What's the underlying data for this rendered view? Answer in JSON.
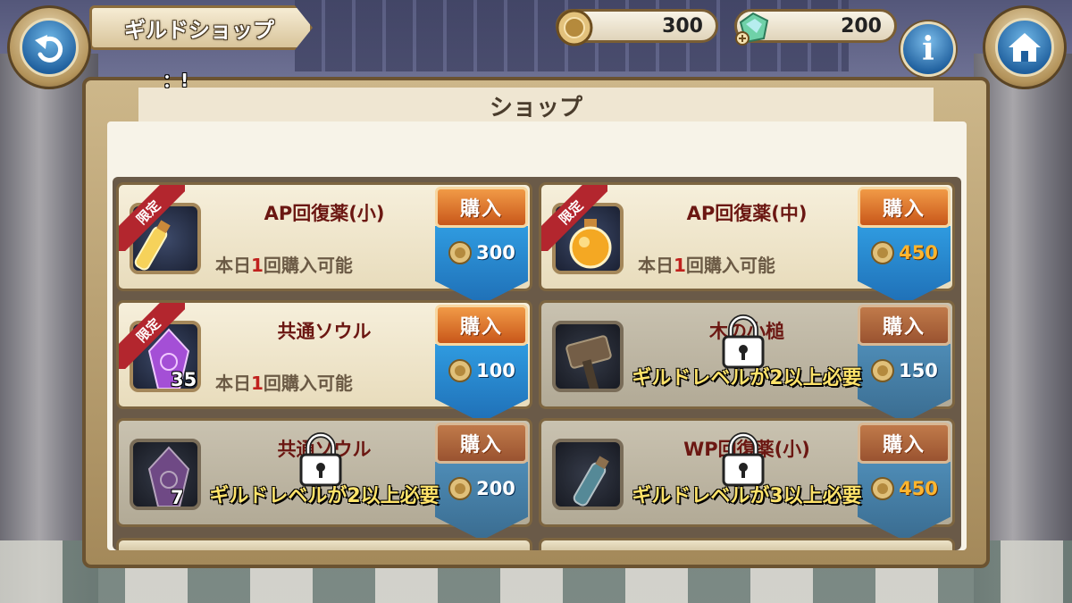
{
  "header": {
    "title": "ギルドショップ",
    "coins": "300",
    "gems": "200",
    "info_label": "i"
  },
  "chat_line": "：!",
  "panel": {
    "title": "ショップ"
  },
  "buy_label": "購入",
  "items": [
    {
      "name": "AP回復薬(小)",
      "limited_tag": "限定",
      "limit_prefix": "本日",
      "limit_count": "1",
      "limit_suffix": "回購入可能",
      "price": "300",
      "quantity": "",
      "lock_text": ""
    },
    {
      "name": "AP回復薬(中)",
      "limited_tag": "限定",
      "limit_prefix": "本日",
      "limit_count": "1",
      "limit_suffix": "回購入可能",
      "price": "450",
      "quantity": "",
      "lock_text": ""
    },
    {
      "name": "共通ソウル",
      "limited_tag": "限定",
      "limit_prefix": "本日",
      "limit_count": "1",
      "limit_suffix": "回購入可能",
      "price": "100",
      "quantity": "35",
      "lock_text": ""
    },
    {
      "name": "木の小槌",
      "limited_tag": "",
      "limit_prefix": "",
      "limit_count": "",
      "limit_suffix": "",
      "price": "150",
      "quantity": "",
      "lock_text": "ギルドレベルが2以上必要"
    },
    {
      "name": "共通ソウル",
      "limited_tag": "",
      "limit_prefix": "",
      "limit_count": "",
      "limit_suffix": "",
      "price": "200",
      "quantity": "7",
      "lock_text": "ギルドレベルが2以上必要"
    },
    {
      "name": "WP回復薬(小)",
      "limited_tag": "",
      "limit_prefix": "",
      "limit_count": "",
      "limit_suffix": "",
      "price": "450",
      "quantity": "",
      "lock_text": "ギルドレベルが3以上必要"
    }
  ],
  "colors": {
    "limit_red": "#c0211d",
    "price_gold": "#ffb52e",
    "lock_text": "#ffe36a",
    "buy_orange": "#e07a2e",
    "price_blue": "#2f9be0"
  }
}
